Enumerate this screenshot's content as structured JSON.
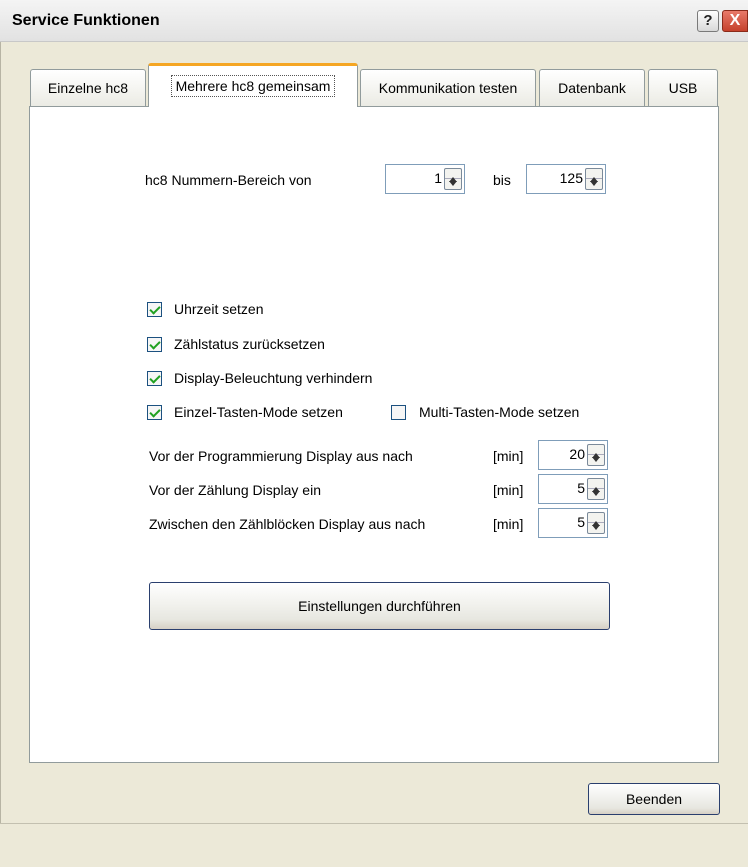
{
  "window": {
    "title": "Service Funktionen",
    "help_label": "?",
    "close_label": "X"
  },
  "tabs": [
    {
      "label": "Einzelne hc8"
    },
    {
      "label": "Mehrere hc8 gemeinsam"
    },
    {
      "label": "Kommunikation testen"
    },
    {
      "label": "Datenbank"
    },
    {
      "label": "USB"
    }
  ],
  "active_tab": "Mehrere hc8 gemeinsam",
  "range": {
    "label": "hc8 Nummern-Bereich von",
    "from_value": "1",
    "to_label": "bis",
    "to_value": "125"
  },
  "options": {
    "uhrzeit": {
      "label": "Uhrzeit setzen",
      "checked": true
    },
    "zaehlstatus": {
      "label": "Zählstatus zurücksetzen",
      "checked": true
    },
    "display_beleuchtung": {
      "label": "Display-Beleuchtung verhindern",
      "checked": true
    },
    "einzel_tasten": {
      "label": "Einzel-Tasten-Mode setzen",
      "checked": true
    },
    "multi_tasten": {
      "label": "Multi-Tasten-Mode setzen",
      "checked": false
    }
  },
  "timings": [
    {
      "label": "Vor der Programmierung Display aus nach",
      "unit": "[min]",
      "value": "20"
    },
    {
      "label": "Vor der Zählung Display ein",
      "unit": "[min]",
      "value": "5"
    },
    {
      "label": "Zwischen den Zählblöcken Display aus nach",
      "unit": "[min]",
      "value": "5"
    }
  ],
  "buttons": {
    "apply_label": "Einstellungen durchführen",
    "exit_label": "Beenden"
  },
  "colors": {
    "active_tab_accent": "#f5a623",
    "check_mark": "#21a121",
    "close_button": "#c5412c"
  }
}
